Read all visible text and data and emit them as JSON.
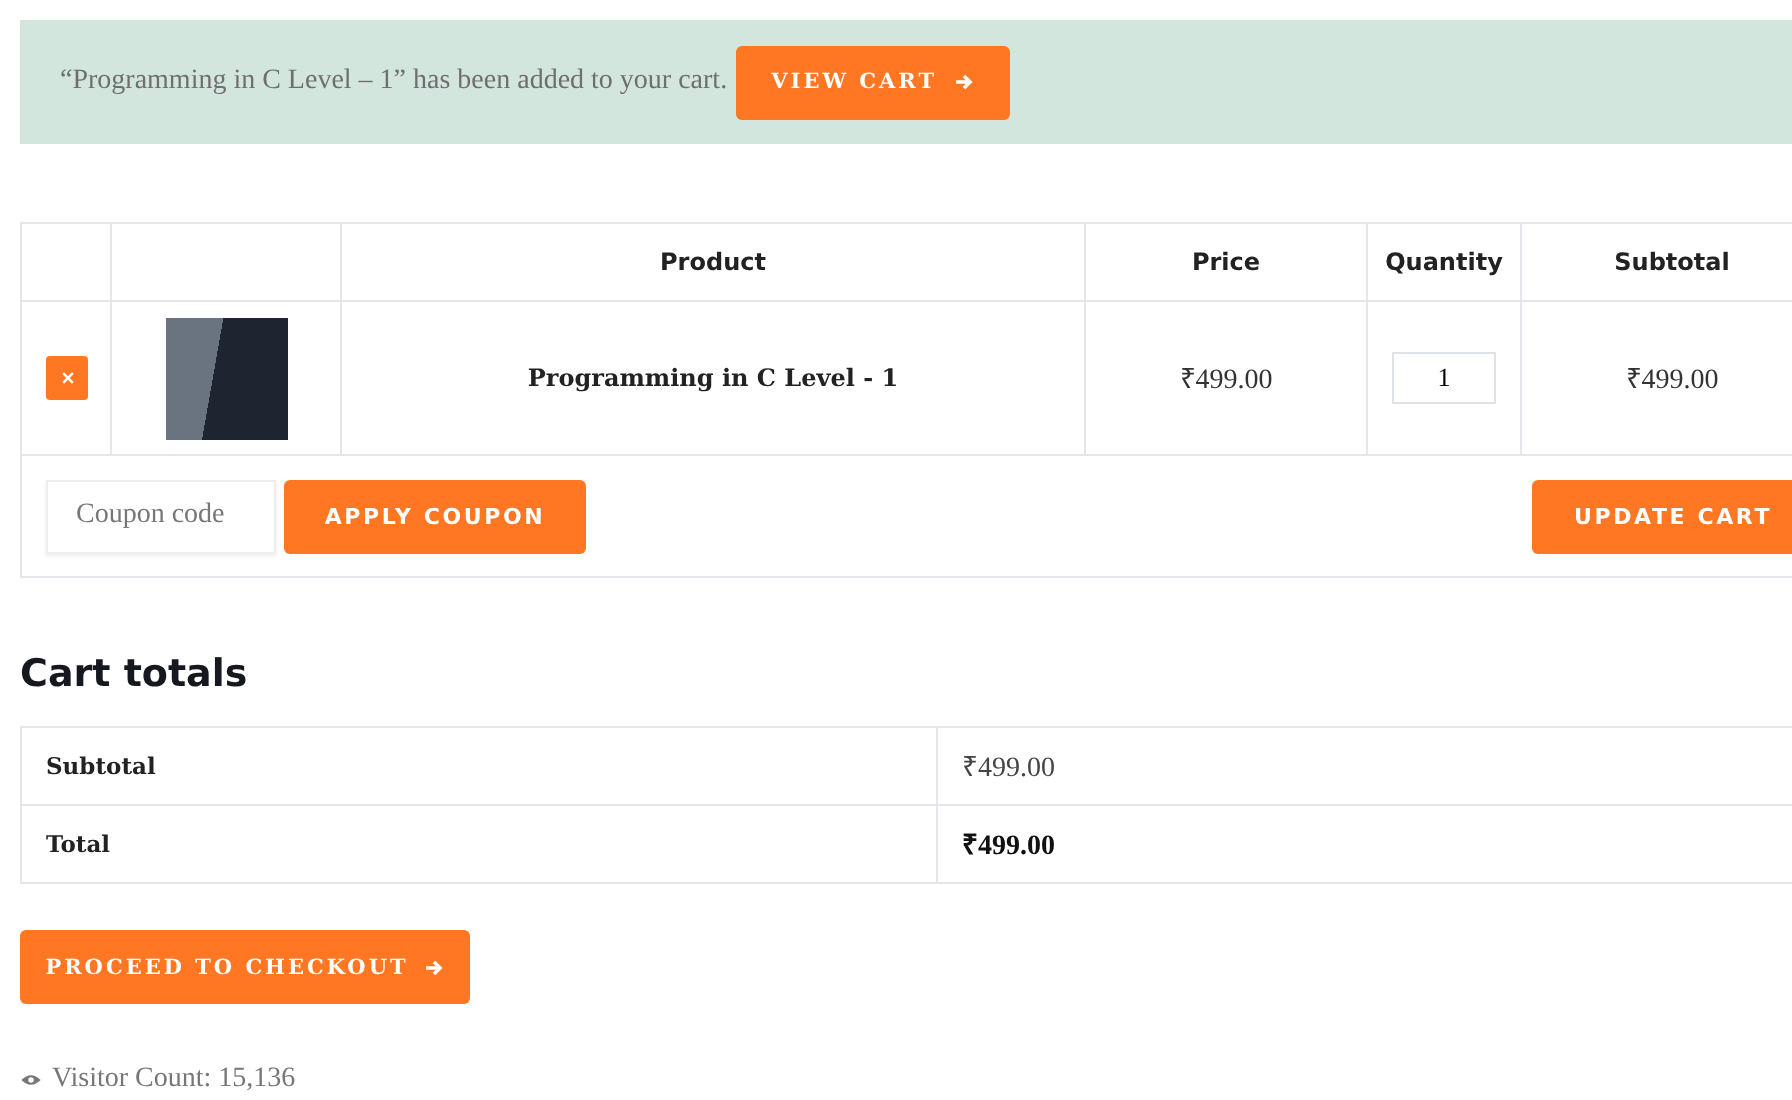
{
  "notice": {
    "message": "“Programming in C Level – 1” has been added to your cart.",
    "button": "VIEW CART"
  },
  "cart_table": {
    "columns": [
      "",
      "",
      "Product",
      "Price",
      "Quantity",
      "Subtotal"
    ],
    "rows": [
      {
        "product": "Programming in C Level - 1",
        "price": "₹499.00",
        "quantity": "1",
        "subtotal": "₹499.00"
      }
    ],
    "coupon": {
      "placeholder": "Coupon code",
      "apply_button": "APPLY COUPON"
    },
    "update_button": "UPDATE CART"
  },
  "cart_totals": {
    "title": "Cart totals",
    "rows": [
      {
        "label": "Subtotal",
        "value": "₹499.00",
        "kind": "normal"
      },
      {
        "label": "Total",
        "value": "₹499.00",
        "kind": "total"
      }
    ],
    "checkout_button": "PROCEED TO CHECKOUT"
  },
  "visitor_count": "Visitor Count: 15,136"
}
